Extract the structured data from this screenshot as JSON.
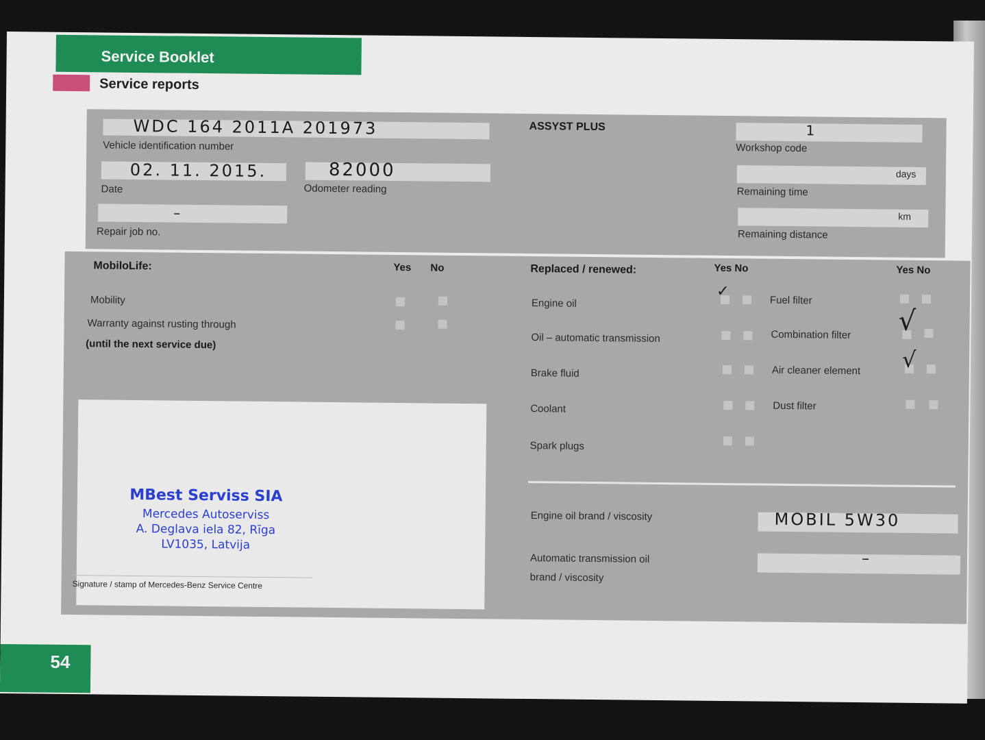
{
  "header": {
    "title": "Service Booklet",
    "subtitle": "Service reports"
  },
  "vehicle": {
    "vin_label": "Vehicle identification number",
    "vin_value": "WDC 164 2011A 201973",
    "date_label": "Date",
    "date_value": "02. 11. 2015.",
    "odometer_label": "Odometer reading",
    "odometer_value": "82000",
    "repair_label": "Repair job no.",
    "repair_value": "–"
  },
  "assyst": {
    "title": "ASSYST PLUS",
    "workshop_label": "Workshop code",
    "workshop_value": "1",
    "remaining_time_label": "Remaining time",
    "remaining_time_unit": "days",
    "remaining_distance_label": "Remaining distance",
    "remaining_distance_unit": "km"
  },
  "mobilo": {
    "title": "MobiloLife:",
    "yes": "Yes",
    "no": "No",
    "items": [
      "Mobility",
      "Warranty against rusting through"
    ],
    "note": "(until the next service due)"
  },
  "replaced": {
    "title": "Replaced / renewed:",
    "yes_no": "Yes No",
    "left_items": [
      "Engine oil",
      "Oil – automatic transmission",
      "Brake fluid",
      "Coolant",
      "Spark plugs"
    ],
    "right_items": [
      "Fuel filter",
      "Combination filter",
      "Air cleaner element",
      "Dust filter"
    ],
    "engine_oil_checked": "yes",
    "combination_filter_checked": "yes",
    "air_cleaner_checked": "yes"
  },
  "oil": {
    "engine_label": "Engine oil brand / viscosity",
    "engine_value": "MOBIL 5W30",
    "atf_label_1": "Automatic transmission oil",
    "atf_label_2": "brand / viscosity",
    "atf_value": "–"
  },
  "stamp": {
    "line1": "MBest Serviss SIA",
    "line2": "Mercedes Autoserviss",
    "line3": "A. Deglava iela 82, Rīga",
    "line4": "LV1035, Latvija"
  },
  "signature_label": "Signature / stamp of Mercedes-Benz Service Centre",
  "page_number": "54",
  "colors": {
    "green": "#1f8c55",
    "pink": "#c84f7a",
    "stamp_blue": "#2a3fd0"
  }
}
